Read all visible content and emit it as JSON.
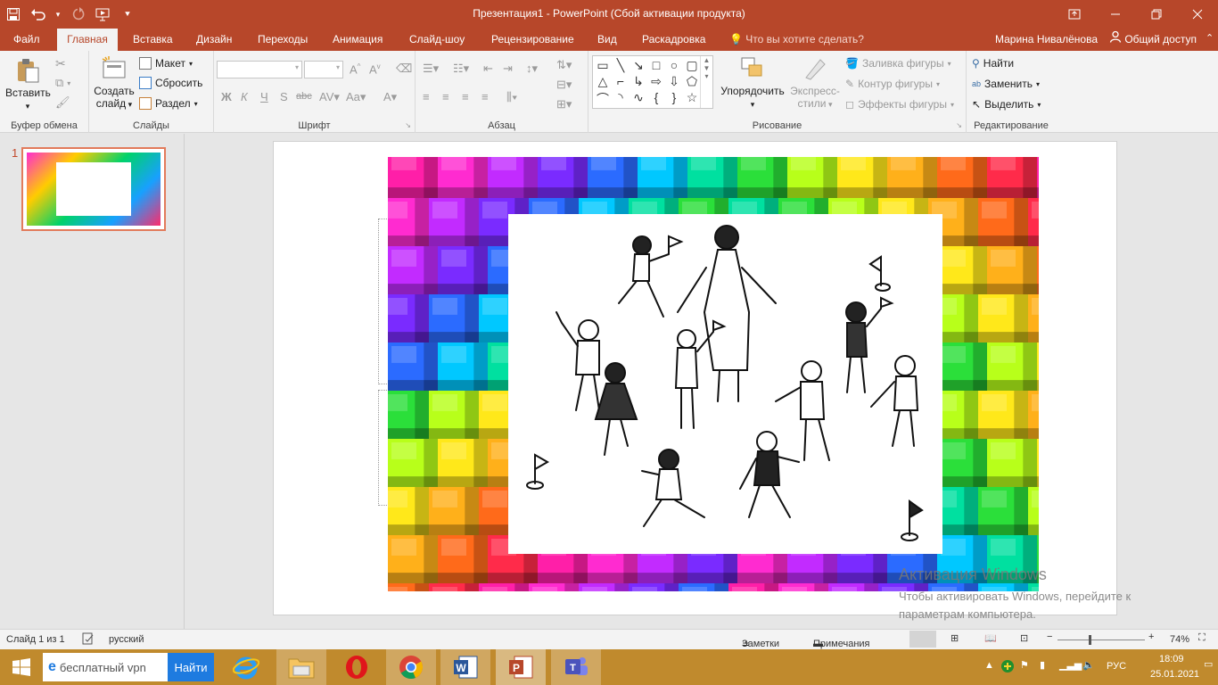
{
  "window": {
    "title": "Презентация1 - PowerPoint (Сбой активации продукта)",
    "qat_icons": [
      "save-icon",
      "undo-icon",
      "redo-icon",
      "present-from-start-icon",
      "customize-qat-icon"
    ],
    "controls": [
      "ribbon-display-icon",
      "minimize-icon",
      "restore-icon",
      "close-icon"
    ]
  },
  "tabs": [
    {
      "label": "Файл",
      "active": false
    },
    {
      "label": "Главная",
      "active": true
    },
    {
      "label": "Вставка",
      "active": false
    },
    {
      "label": "Дизайн",
      "active": false
    },
    {
      "label": "Переходы",
      "active": false
    },
    {
      "label": "Анимация",
      "active": false
    },
    {
      "label": "Слайд-шоу",
      "active": false
    },
    {
      "label": "Рецензирование",
      "active": false
    },
    {
      "label": "Вид",
      "active": false
    },
    {
      "label": "Раскадровка",
      "active": false
    }
  ],
  "tell_me": "Что вы хотите сделать?",
  "user_name": "Марина Нивалёнова",
  "share_label": "Общий доступ",
  "ribbon": {
    "clipboard": {
      "label": "Буфер обмена",
      "paste": "Вставить"
    },
    "slides": {
      "label": "Слайды",
      "new_slide": "Создать",
      "new_slide_line2": "слайд",
      "layout": "Макет",
      "reset": "Сбросить",
      "section": "Раздел"
    },
    "font": {
      "label": "Шрифт",
      "bold": "Ж",
      "italic": "К",
      "underline": "Ч",
      "shadow": "S",
      "strike": "abc"
    },
    "paragraph": {
      "label": "Абзац"
    },
    "drawing": {
      "label": "Рисование",
      "arrange": "Упорядочить",
      "quick_styles": "Экспресс-",
      "quick_styles_line2": "стили",
      "fill": "Заливка фигуры",
      "outline": "Контур фигуры",
      "effects": "Эффекты фигуры"
    },
    "editing": {
      "label": "Редактирование",
      "find": "Найти",
      "replace": "Заменить",
      "select": "Выделить"
    }
  },
  "thumbnail": {
    "number": "1"
  },
  "activation": {
    "heading": "Активация Windows",
    "line1": "Чтобы активировать Windows, перейдите к",
    "line2": "параметрам компьютера."
  },
  "status": {
    "slide": "Слайд 1 из 1",
    "language": "русский",
    "notes": "Заметки",
    "comments": "Примечания",
    "zoom": "74%",
    "zoom_level": 0.74
  },
  "taskbar": {
    "search_value": "бесплатный vpn",
    "search_button": "Найти",
    "apps": [
      "windows-start-icon",
      "internet-explorer-icon",
      "file-explorer-icon",
      "opera-icon",
      "chrome-icon",
      "word-icon",
      "powerpoint-icon",
      "teams-icon"
    ],
    "lang": "РУС",
    "time": "18:09",
    "date": "25.01.2021"
  }
}
